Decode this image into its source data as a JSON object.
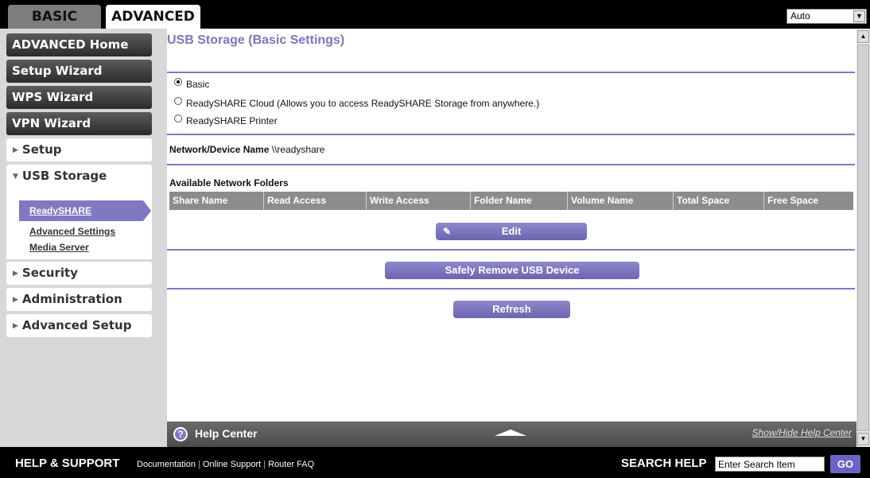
{
  "tabs": {
    "basic": "BASIC",
    "advanced": "ADVANCED"
  },
  "language_select": {
    "selected": "Auto"
  },
  "sidebar": {
    "advanced_home": "ADVANCED Home",
    "setup_wizard": "Setup Wizard",
    "wps_wizard": "WPS Wizard",
    "vpn_wizard": "VPN Wizard",
    "setup": "Setup",
    "usb_storage": "USB Storage",
    "usb_sub": [
      "ReadySHARE",
      "Advanced Settings",
      "Media Server"
    ],
    "security": "Security",
    "administration": "Administration",
    "advanced_setup": "Advanced Setup"
  },
  "main": {
    "title": "USB Storage (Basic Settings)",
    "radios": [
      {
        "label": "Basic",
        "checked": true
      },
      {
        "label": "ReadySHARE Cloud (Allows you to access ReadySHARE Storage from anywhere.)",
        "checked": false
      },
      {
        "label": "ReadySHARE Printer",
        "checked": false
      }
    ],
    "network_device_label": "Network/Device Name",
    "network_device_value": "\\\\readyshare",
    "folders_label": "Available Network Folders",
    "columns": [
      "Share Name",
      "Read Access",
      "Write Access",
      "Folder Name",
      "Volume Name",
      "Total Space",
      "Free Space"
    ],
    "edit_label": "Edit",
    "safely_remove_label": "Safely Remove USB Device",
    "refresh_label": "Refresh"
  },
  "help_center": {
    "title": "Help Center",
    "toggle": "Show/Hide Help Center"
  },
  "footer": {
    "title": "HELP & SUPPORT",
    "links": [
      "Documentation",
      "Online Support",
      "Router FAQ"
    ],
    "search_label": "SEARCH HELP",
    "search_placeholder": "Enter Search Item",
    "go_label": "GO"
  },
  "colors": {
    "accent": "#8079c1",
    "title": "#7d75c2",
    "header_bg": "#000000",
    "table_header": "#8c8c8c"
  }
}
